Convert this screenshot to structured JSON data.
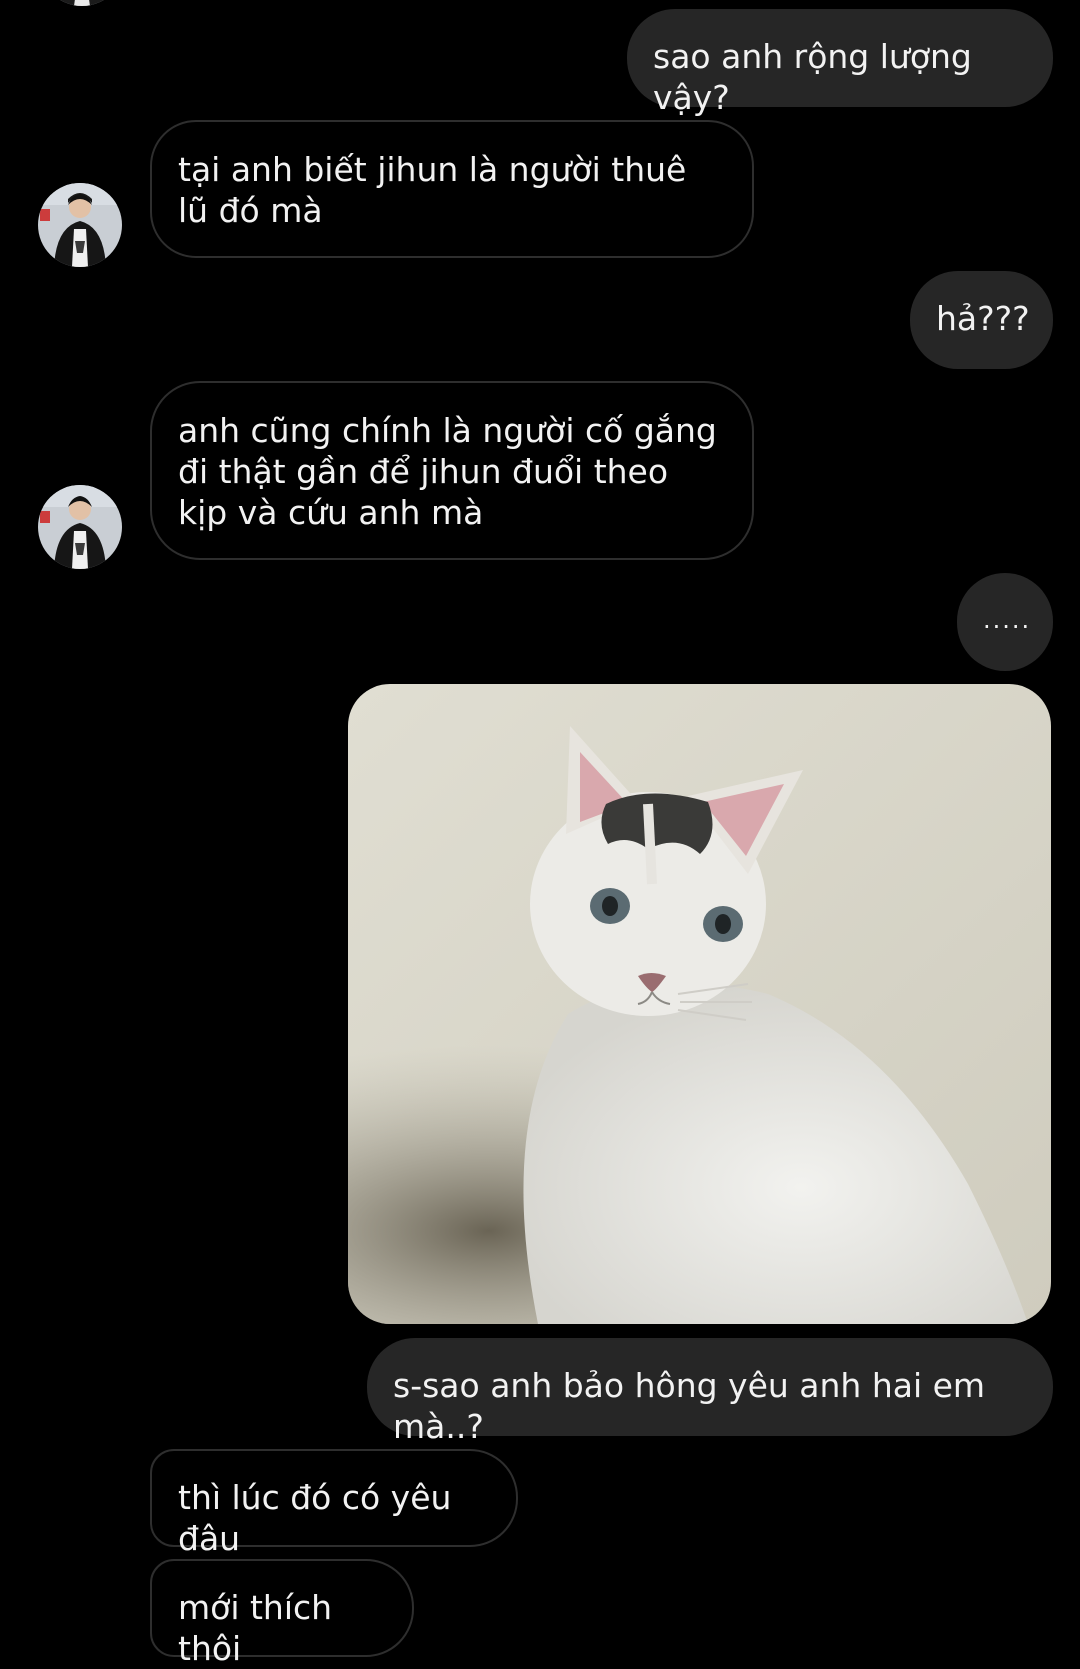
{
  "conversation": {
    "messages": [
      {
        "from": "me",
        "kind": "text",
        "text": "sao anh rộng lượng vậy?"
      },
      {
        "from": "them",
        "kind": "text",
        "text": "tại anh biết jihun là người thuê lũ đó mà"
      },
      {
        "from": "me",
        "kind": "text",
        "text": "hả???"
      },
      {
        "from": "them",
        "kind": "text",
        "text": "anh cũng chính là người cố gắng đi thật gần để jihun đuổi theo kịp và cứu anh mà"
      },
      {
        "from": "me",
        "kind": "text",
        "text": "....."
      },
      {
        "from": "me",
        "kind": "image",
        "image": "white-cat-photo"
      },
      {
        "from": "me",
        "kind": "text",
        "text": "s-sao anh bảo hông yêu anh hai em mà..?"
      },
      {
        "from": "them",
        "kind": "text",
        "text": "thì lúc đó có yêu đâu"
      },
      {
        "from": "them",
        "kind": "text",
        "text": "mới thích thôi"
      }
    ]
  },
  "colors": {
    "background": "#000000",
    "sent_bubble": "#262626",
    "received_border": "#2e2e2e",
    "text": "#f2f2f2"
  }
}
